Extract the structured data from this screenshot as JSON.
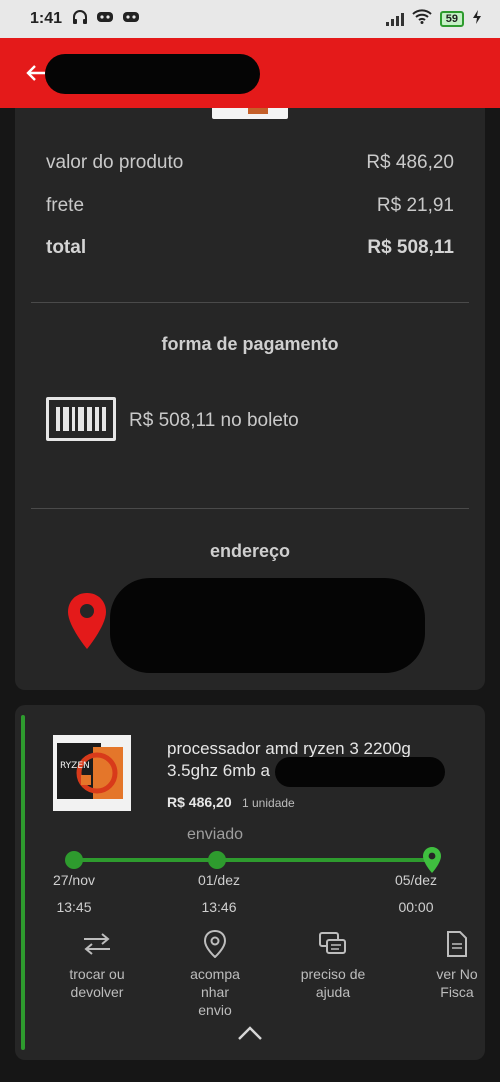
{
  "status_bar": {
    "time": "1:41",
    "battery": "59"
  },
  "summary": {
    "product_value_label": "valor do produto",
    "product_value": "R$ 486,20",
    "shipping_label": "frete",
    "shipping_value": "R$ 21,91",
    "total_label": "total",
    "total_value": "R$ 508,11"
  },
  "payment": {
    "title": "forma de pagamento",
    "method_text": "R$ 508,11 no boleto"
  },
  "address": {
    "title": "endereço"
  },
  "item": {
    "name_line1": "processador amd ryzen 3 2200g",
    "name_line2": "3.5ghz 6mb a",
    "price": "R$ 486,20",
    "quantity": "1 unidade",
    "status": "enviado",
    "image_label": "RYZEN",
    "timeline": [
      {
        "date": "27/nov",
        "time": "13:45"
      },
      {
        "date": "01/dez",
        "time": "13:46"
      },
      {
        "date": "05/dez",
        "time": "00:00"
      }
    ]
  },
  "actions": [
    {
      "icon": "swap-arrows-icon",
      "label_line1": "trocar ou",
      "label_line2": "devolver",
      "label_line3": ""
    },
    {
      "icon": "location-pin-icon",
      "label_line1": "acompa",
      "label_line2": "nhar",
      "label_line3": "envio"
    },
    {
      "icon": "chat-bubbles-icon",
      "label_line1": "preciso de",
      "label_line2": "ajuda",
      "label_line3": ""
    },
    {
      "icon": "document-icon",
      "label_line1": "ver No",
      "label_line2": "Fisca",
      "label_line3": ""
    }
  ],
  "colors": {
    "accent_red": "#e41a1a",
    "success_green": "#2e9b2e",
    "card_bg": "#262626"
  }
}
